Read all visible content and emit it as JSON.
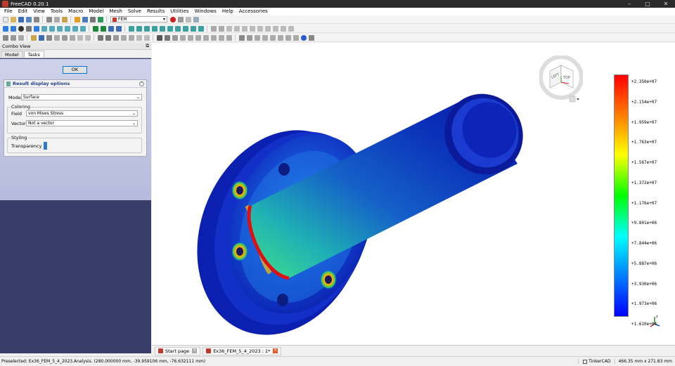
{
  "window": {
    "title": "FreeCAD 0.20.1",
    "minimize": "–",
    "maximize": "□",
    "close": "✕"
  },
  "menu": [
    "File",
    "Edit",
    "View",
    "Tools",
    "Macro",
    "Model",
    "Mesh",
    "Solve",
    "Results",
    "Utilities",
    "Windows",
    "Help",
    "Accessories"
  ],
  "toolbar": {
    "workbench": "FEM"
  },
  "combo_view": {
    "title": "Combo View",
    "tabs": [
      "Model",
      "Tasks"
    ],
    "ok_label": "OK",
    "panel_title": "Result display options",
    "mode_label": "Mode",
    "mode_value": "Surface",
    "coloring_label": "Coloring",
    "field_label": "Field",
    "field_value": "von Mises Stress",
    "vector_label": "Vector",
    "vector_value": "Not a vector",
    "styling_label": "Styling",
    "transparency_label": "Transparency"
  },
  "navcube": {
    "face_top": "TOP",
    "face_left": "LEFT"
  },
  "legend": {
    "labels": [
      "+2.350e+07",
      "+2.154e+07",
      "+1.959e+07",
      "+1.763e+07",
      "+1.567e+07",
      "+1.372e+07",
      "+1.176e+07",
      "+9.801e+06",
      "+7.844e+06",
      "+5.887e+06",
      "+3.930e+06",
      "+1.973e+06",
      "+1.610e+04"
    ],
    "colors": [
      "#ff0000",
      "#00ff00",
      "#0000ff"
    ]
  },
  "doc_tabs": [
    {
      "label": "Start page"
    },
    {
      "label": "Ex36_FEM_5_4_2023 : 1*"
    }
  ],
  "status": {
    "message": "Preselected: Ex36_FEM_5_4_2023.Analysis. (280.000000 mm, -39.959106 mm, -76.632111 mm)",
    "nav_style": "TinkerCAD",
    "dimensions": "466.35 mm x 271.83 mm"
  }
}
